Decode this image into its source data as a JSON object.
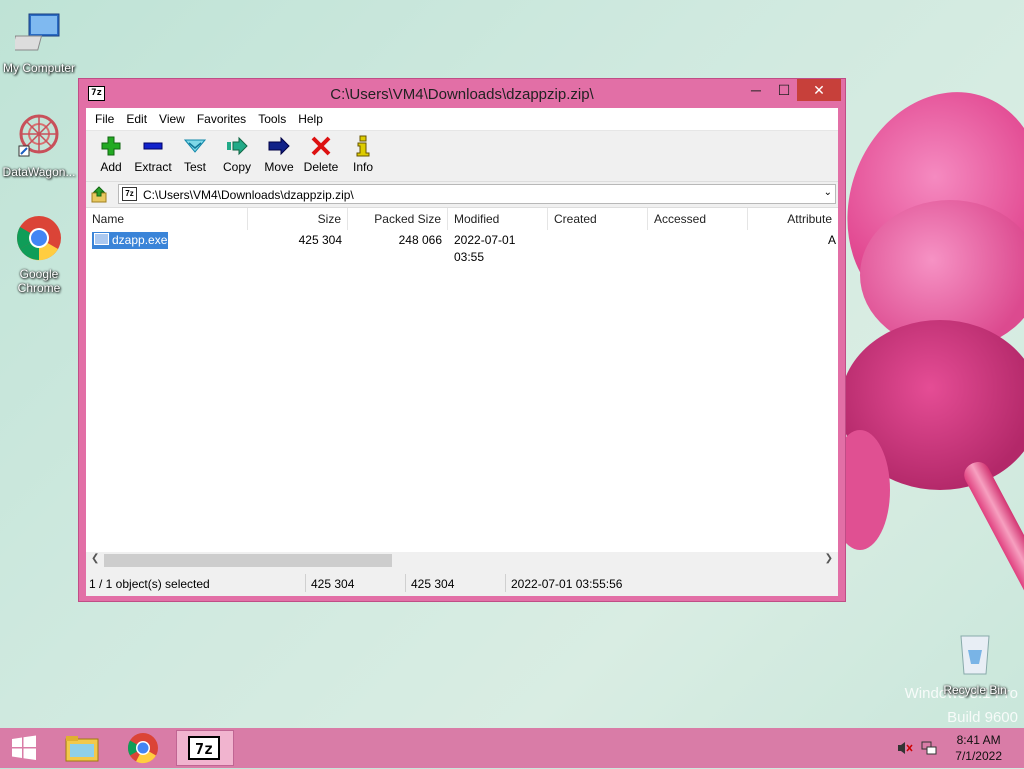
{
  "desktop": {
    "icons": [
      {
        "label": "My Computer"
      },
      {
        "label": "DataWagon..."
      },
      {
        "label": "Google Chrome"
      },
      {
        "label": "Recycle Bin"
      }
    ],
    "watermark": {
      "line1": "Windows 8.1 Pro",
      "line2": "Build 9600"
    }
  },
  "window": {
    "title": "C:\\Users\\VM4\\Downloads\\dzappzip.zip\\",
    "app_icon": "7z",
    "controls": {
      "minimize": "─",
      "maximize": "☐",
      "close": "✕"
    },
    "menu": [
      "File",
      "Edit",
      "View",
      "Favorites",
      "Tools",
      "Help"
    ],
    "toolbar": [
      {
        "label": "Add",
        "icon": "add-icon",
        "color": "#22aa22"
      },
      {
        "label": "Extract",
        "icon": "extract-icon",
        "color": "#1122cc"
      },
      {
        "label": "Test",
        "icon": "test-icon",
        "color": "#22aabb"
      },
      {
        "label": "Copy",
        "icon": "copy-icon",
        "color": "#22aa88"
      },
      {
        "label": "Move",
        "icon": "move-icon",
        "color": "#112288"
      },
      {
        "label": "Delete",
        "icon": "delete-icon",
        "color": "#dd1111"
      },
      {
        "label": "Info",
        "icon": "info-icon",
        "color": "#ccbb00"
      }
    ],
    "address": {
      "value": "C:\\Users\\VM4\\Downloads\\dzappzip.zip\\",
      "icon": "7z"
    },
    "columns": [
      "Name",
      "Size",
      "Packed Size",
      "Modified",
      "Created",
      "Accessed",
      "Attribute"
    ],
    "rows": [
      {
        "name": "dzapp.exe",
        "size": "425 304",
        "packed": "248 066",
        "modified": "2022-07-01 03:55",
        "created": "",
        "accessed": "",
        "attr": "A"
      }
    ],
    "status": {
      "selected": "1 / 1 object(s) selected",
      "size": "425 304",
      "packed": "425 304",
      "modified": "2022-07-01 03:55:56"
    }
  },
  "taskbar": {
    "items": [
      "start",
      "file-explorer",
      "google-chrome",
      "7-zip"
    ],
    "time": "8:41 AM",
    "date": "7/1/2022"
  }
}
